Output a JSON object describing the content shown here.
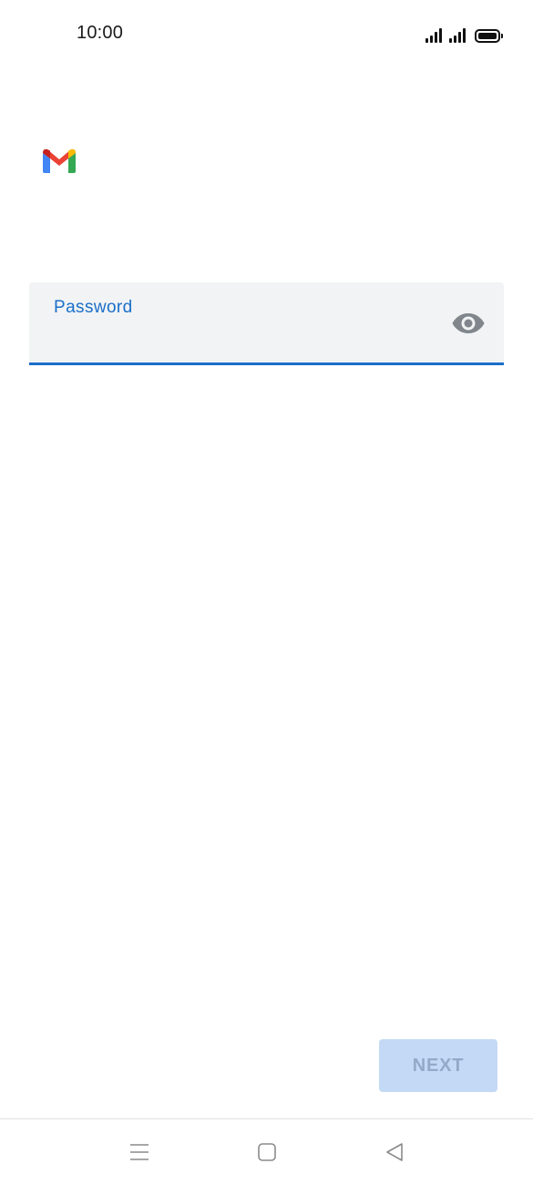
{
  "status_bar": {
    "time": "10:00",
    "icons": [
      "signal-icon",
      "signal-icon",
      "battery-icon"
    ]
  },
  "app": {
    "logo_icon": "gmail-logo-icon"
  },
  "password_field": {
    "label": "Password",
    "value": "",
    "toggle_icon": "eye-icon",
    "accent_color": "#1a6fc9",
    "background_color": "#f1f3f4"
  },
  "actions": {
    "next_label": "NEXT",
    "next_enabled": false,
    "next_background": "#c4d9f6"
  },
  "nav_bar": {
    "icons": [
      "menu-icon",
      "home-icon",
      "back-icon"
    ]
  }
}
